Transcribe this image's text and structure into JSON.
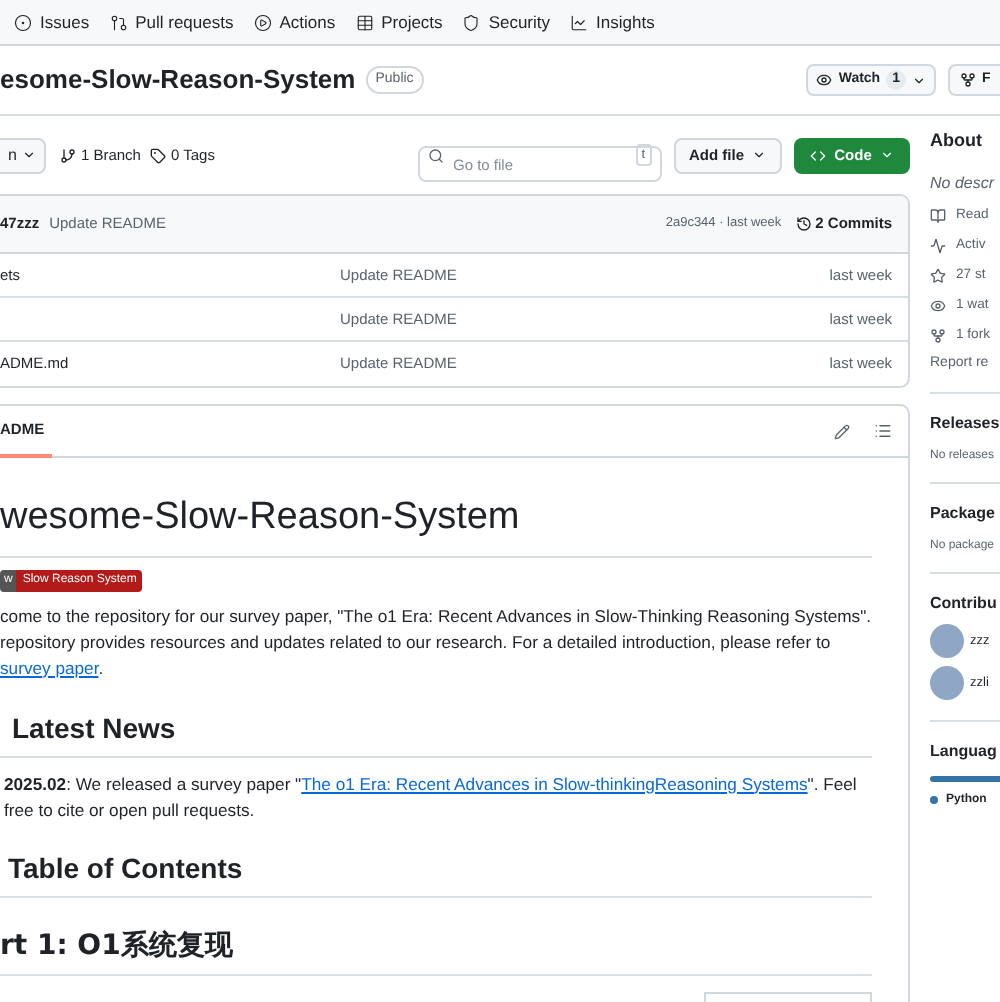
{
  "nav_tabs": [
    {
      "label": "Issues"
    },
    {
      "label": "Pull requests"
    },
    {
      "label": "Actions"
    },
    {
      "label": "Projects"
    },
    {
      "label": "Security"
    },
    {
      "label": "Insights"
    }
  ],
  "repo": {
    "name": "esome-Slow-Reason-System",
    "visibility": "Public"
  },
  "watch": {
    "label": "Watch",
    "count": "1"
  },
  "fork": {
    "label": "F"
  },
  "branch": {
    "label": "n"
  },
  "branches": "1 Branch",
  "tags": "0 Tags",
  "search": {
    "placeholder": "Go to file",
    "shortcut": "t"
  },
  "add_file": "Add file",
  "code_button": "Code",
  "latest_commit": {
    "author": "47zzz",
    "message": "Update README",
    "hash_time": "2a9c344 · last week",
    "commits": "2 Commits"
  },
  "files": [
    {
      "name": "ets",
      "message": "Update README",
      "time": "last week"
    },
    {
      "message": "Update README",
      "time": "last week"
    },
    {
      "name": "ADME.md",
      "message": "Update README",
      "time": "last week"
    }
  ],
  "readme": {
    "tab": {
      "label": "ADME",
      "selected": true
    },
    "title": "wesome-Slow-Reason-System",
    "badge": {
      "left": "w",
      "right": "Slow Reason System"
    },
    "intro": {
      "line_1": "come to the repository for our survey paper, \"The o1 Era: Recent Advances in Slow-Thinking Reasoning Systems\".",
      "line_2": "repository provides resources and updates related to our research. For a detailed introduction, please refer to",
      "link": "survey paper",
      "tail": "."
    },
    "news": {
      "heading": "Latest News",
      "items": [
        {
          "date": "2025.02",
          "before": ": We released a survey paper \"",
          "link": "The o1 Era: Recent Advances in Slow-thinkingReasoning Systems",
          "after": "\". Feel",
          "line_2": "free to cite or open pull requests."
        }
      ]
    },
    "toc_heading": "Table of Contents",
    "part_heading": "rt 1: O1系统复现"
  },
  "sidebar": {
    "about": "About",
    "description": "No descr",
    "links": [
      {
        "label": "Read"
      },
      {
        "label": "Activ"
      },
      {
        "label": "27 st"
      },
      {
        "label": "1 wat"
      },
      {
        "label": "1 fork"
      }
    ],
    "report": "Report re",
    "releases": {
      "heading": "Releases",
      "text": "No releases"
    },
    "packages": {
      "heading": "Package",
      "text": "No package"
    },
    "contributors": {
      "heading": "Contribu",
      "people": [
        {
          "name": "zzz"
        },
        {
          "name": "zzli"
        }
      ]
    },
    "languages": {
      "heading": "Languag",
      "items": [
        {
          "name": "Python",
          "color": "#3572a5"
        }
      ]
    }
  }
}
